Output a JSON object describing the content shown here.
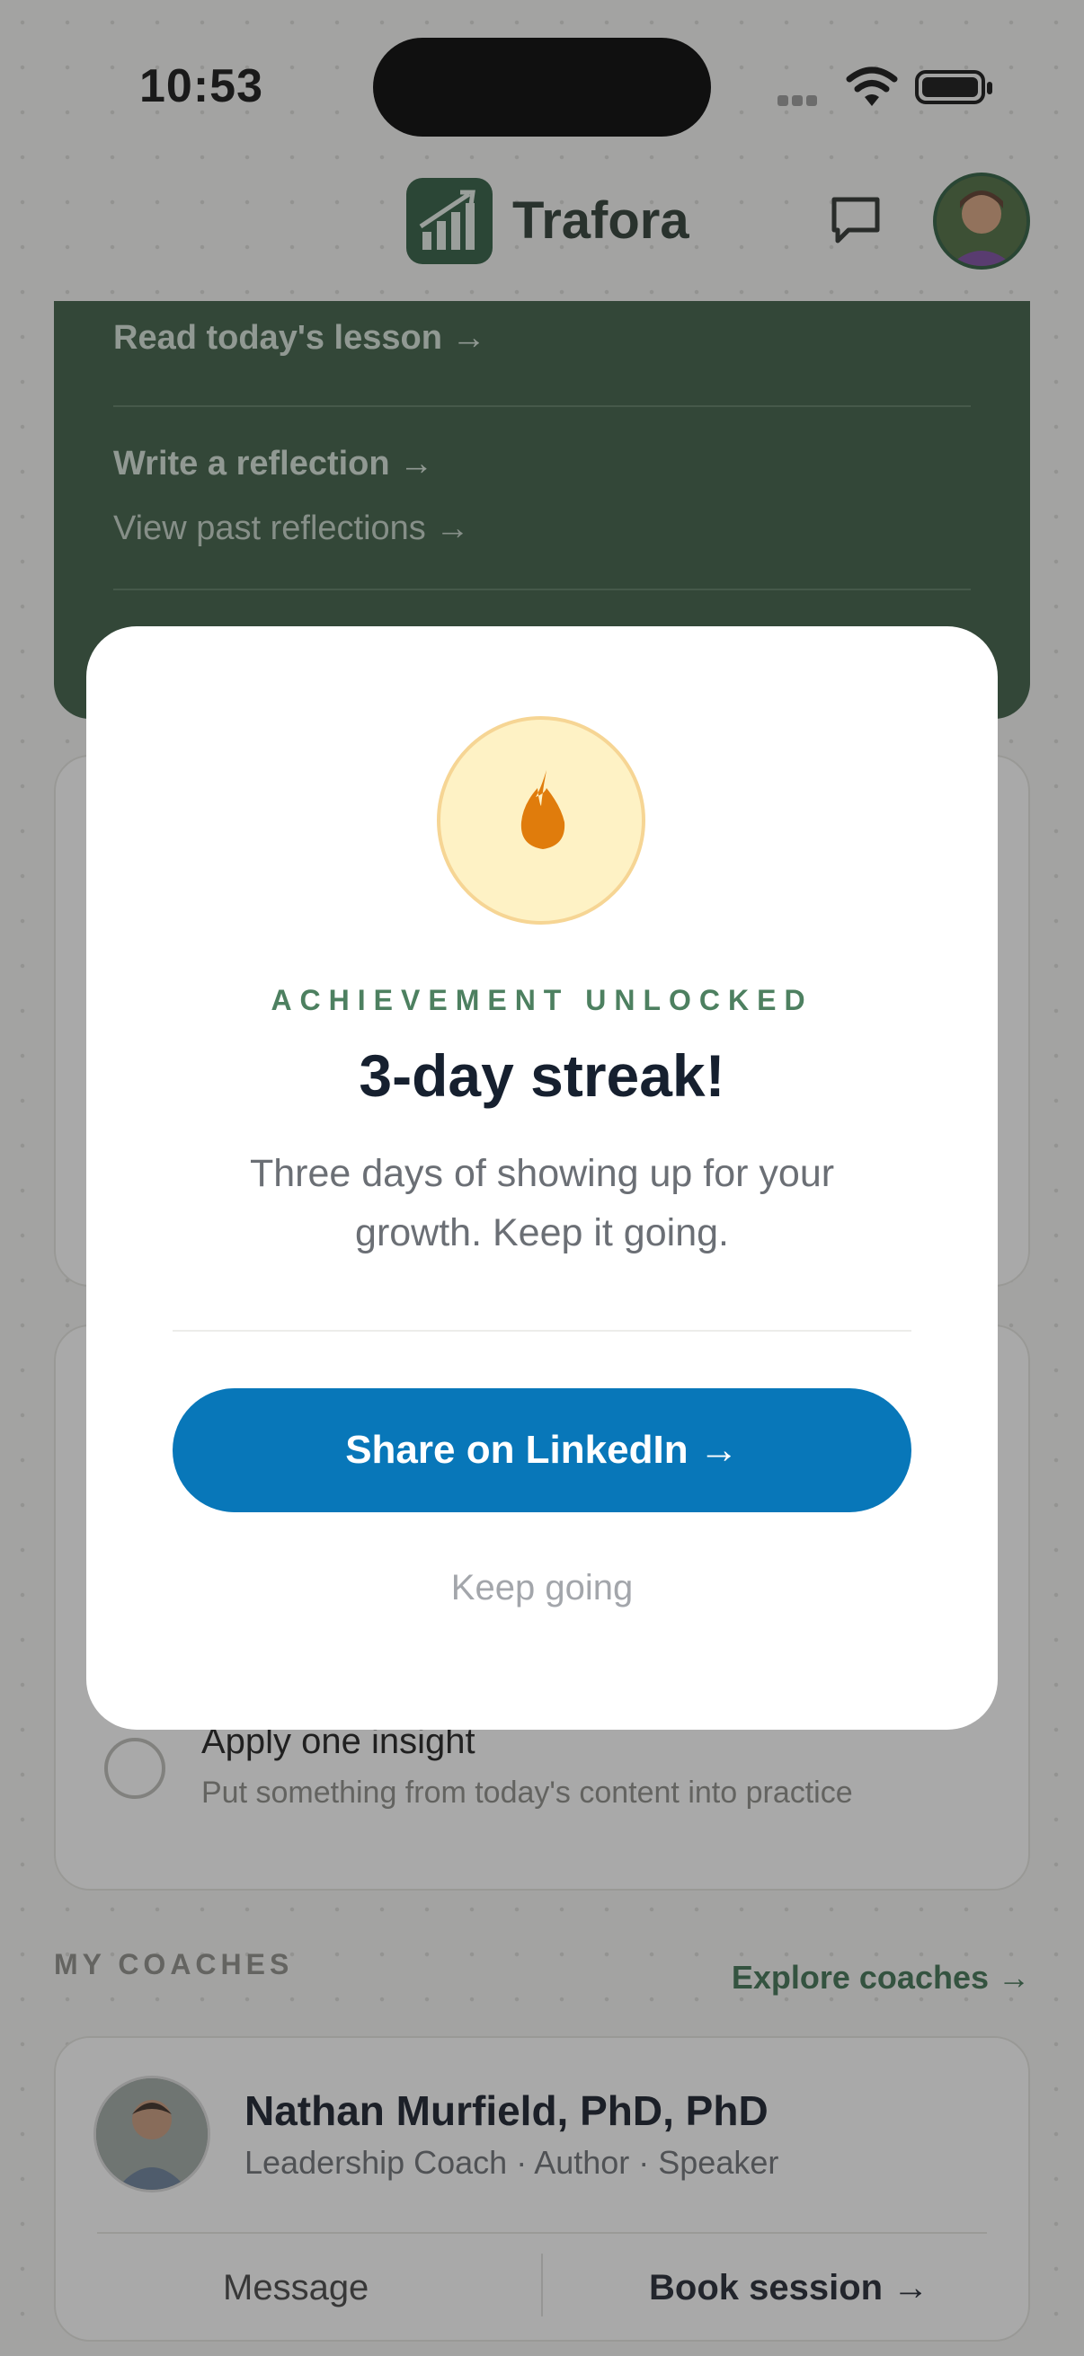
{
  "status_bar": {
    "time": "10:53"
  },
  "header": {
    "brand": "Trafora",
    "message_icon": "chat-bubble-icon",
    "avatar_icon": "user-avatar"
  },
  "daily_card": {
    "links": [
      "Read today's lesson →",
      "Write a reflection →",
      "View past reflections →"
    ]
  },
  "tasks": [
    {
      "title": "Apply one insight",
      "subtitle": "Put something from today's content into practice"
    }
  ],
  "coaches": {
    "section_label": "MY COACHES",
    "explore_link": "Explore coaches →",
    "items": [
      {
        "name": "Nathan Murfield, PhD, PhD",
        "role": "Leadership Coach · Author · Speaker",
        "message_label": "Message",
        "book_label": "Book session →"
      }
    ]
  },
  "modal": {
    "icon": "flame-icon",
    "eyebrow": "ACHIEVEMENT UNLOCKED",
    "title": "3-day streak!",
    "description": "Three days of showing up for your growth. Keep it going.",
    "primary_button": "Share on LinkedIn →",
    "secondary_button": "Keep going"
  },
  "colors": {
    "brand_green": "#2e5a40",
    "card_green": "#3b5c44",
    "linkedin_blue": "#0877b9",
    "flame_orange": "#e07c0c"
  }
}
